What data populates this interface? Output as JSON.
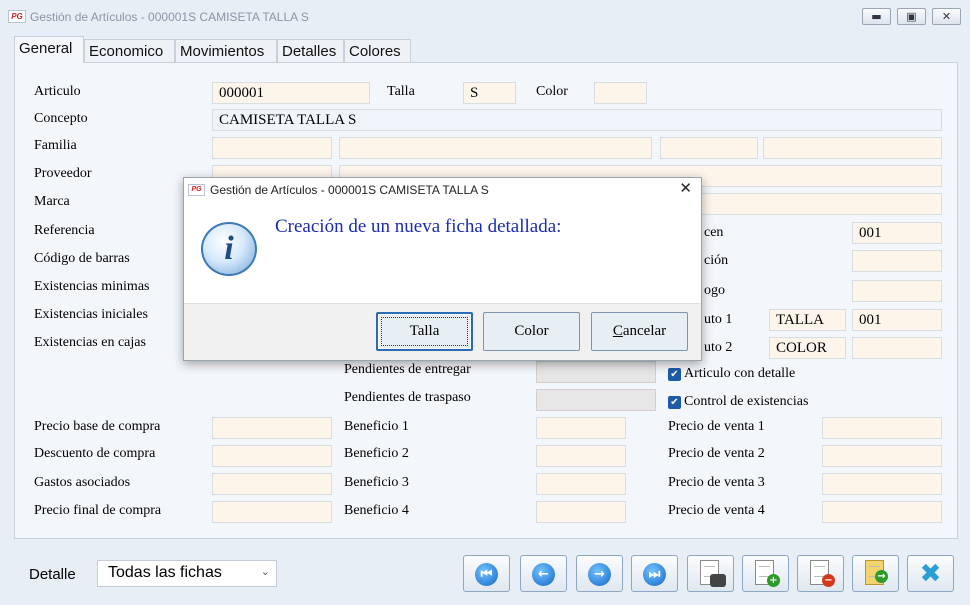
{
  "window": {
    "title": "Gestión de Artículos - 000001S CAMISETA TALLA S",
    "logo_text": "PG",
    "minimize_glyph": "▬",
    "maximize_glyph": "▣",
    "close_glyph": "✕"
  },
  "tabs": [
    "General",
    "Economico",
    "Movimientos",
    "Detalles",
    "Colores"
  ],
  "form": {
    "articulo_label": "Articulo",
    "articulo_value": "000001",
    "talla_label": "Talla",
    "talla_value": "S",
    "color_label": "Color",
    "color_value": "",
    "concepto_label": "Concepto",
    "concepto_value": "CAMISETA TALLA S",
    "familia_label": "Familia",
    "proveedor_label": "Proveedor",
    "marca_label": "Marca",
    "referencia_label": "Referencia",
    "codigo_barras_label": "Código de barras",
    "exist_minimas_label": "Existencias minimas",
    "exist_iniciales_label": "Existencias iniciales",
    "exist_cajas_label": "Existencias en cajas",
    "almacen_label_visible": "cen",
    "almacen_value": "001",
    "ubicacion_label_visible": "ción",
    "catalogo_label_visible": "ogo",
    "atributo1_label_visible": "uto 1",
    "atributo1_name": "TALLA",
    "atributo1_value": "001",
    "atributo2_label_visible": "uto 2",
    "atributo2_name": "COLOR",
    "atributo2_value": "",
    "pend_entregar_label": "Pendientes de entregar",
    "pend_traspaso_label": "Pendientes de traspaso",
    "articulo_detalle_label": "Articulo con detalle",
    "control_existencias_label": "Control de existencias",
    "check_glyph": "✔",
    "precio_base_label": "Precio base de compra",
    "descuento_label": "Descuento de compra",
    "gastos_label": "Gastos asociados",
    "precio_final_label": "Precio final de compra",
    "beneficio1_label": "Beneficio 1",
    "beneficio2_label": "Beneficio 2",
    "beneficio3_label": "Beneficio 3",
    "beneficio4_label": "Beneficio 4",
    "pv1_label": "Precio de venta 1",
    "pv2_label": "Precio de venta 2",
    "pv3_label": "Precio de venta 3",
    "pv4_label": "Precio de venta 4"
  },
  "footer": {
    "detalle_label": "Detalle",
    "detalle_selected": "Todas las fichas",
    "caret": "⌄",
    "nav": {
      "first": "⏮",
      "prev": "←",
      "next": "→",
      "last": "⏭",
      "plus": "+",
      "minus": "−",
      "close": "✖"
    }
  },
  "dialog": {
    "title": "Gestión de Artículos - 000001S CAMISETA TALLA S",
    "close_glyph": "✕",
    "icon": "i",
    "message": "Creación de un nueva ficha detallada:",
    "btn_talla": "Talla",
    "btn_color": "Color",
    "btn_cancelar_first": "C",
    "btn_cancelar_rest": "ancelar"
  }
}
